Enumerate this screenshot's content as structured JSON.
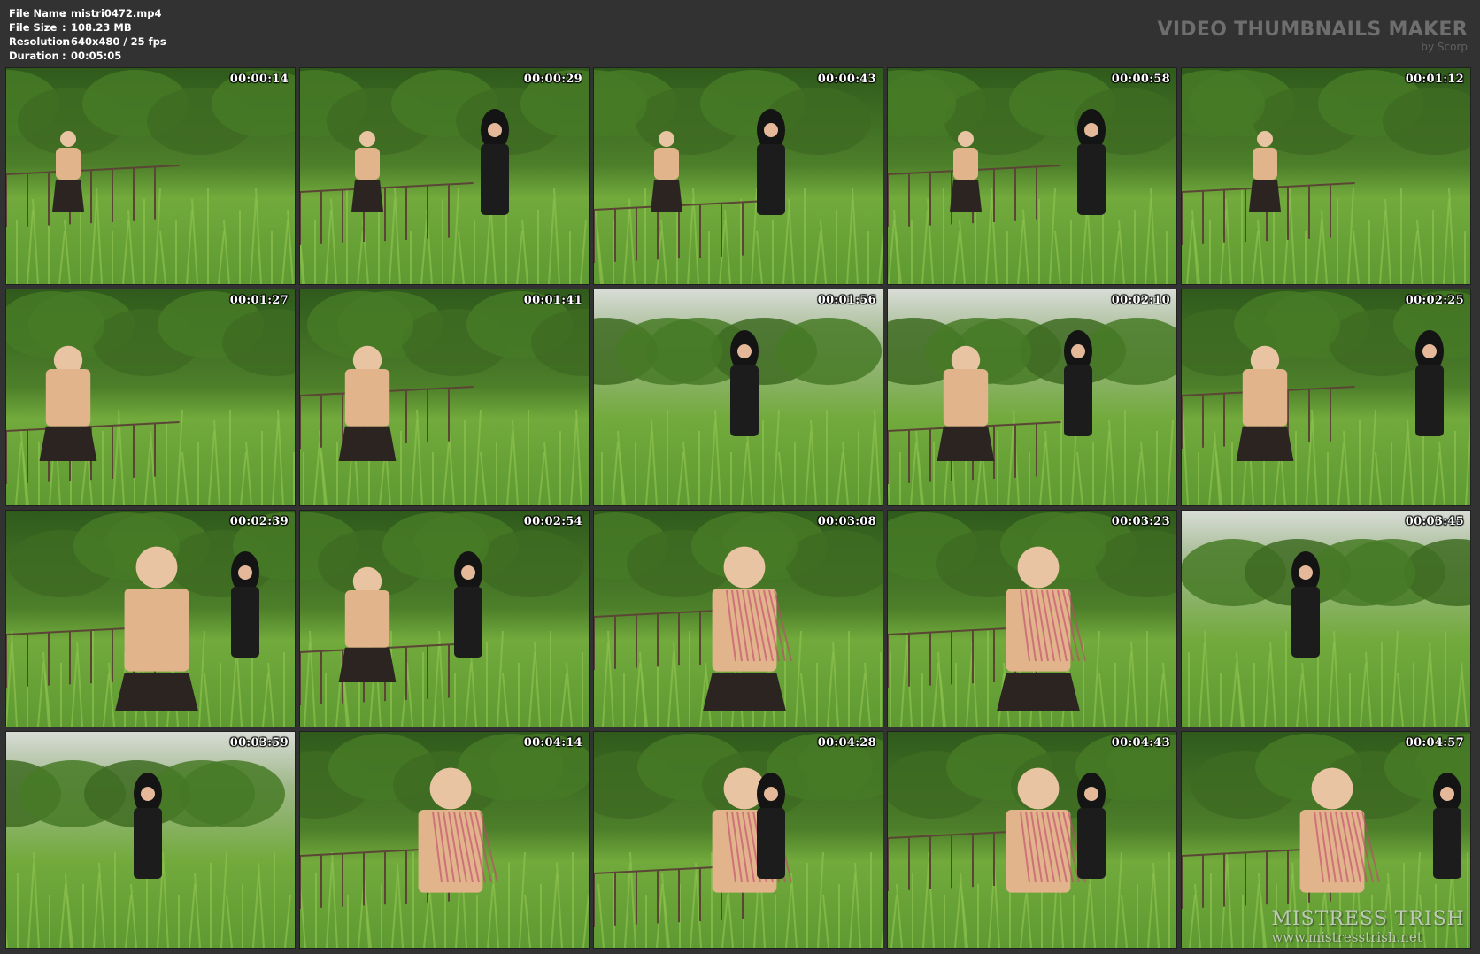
{
  "header": {
    "info": [
      {
        "label": "File Name",
        "sep": ":",
        "value": "mistri0472.mp4"
      },
      {
        "label": "File Size",
        "sep": ":",
        "value": "108.23 MB"
      },
      {
        "label": "Resolution",
        "sep": ":",
        "value": "640x480 / 25 fps"
      },
      {
        "label": "Duration",
        "sep": ":",
        "value": "00:05:05"
      }
    ],
    "brand_title": "VIDEO THUMBNAILS MAKER",
    "brand_sub": "by Scorp"
  },
  "thumbnails": [
    {
      "time": "00:00:14"
    },
    {
      "time": "00:00:29"
    },
    {
      "time": "00:00:43"
    },
    {
      "time": "00:00:58"
    },
    {
      "time": "00:01:12"
    },
    {
      "time": "00:01:27"
    },
    {
      "time": "00:01:41"
    },
    {
      "time": "00:01:56"
    },
    {
      "time": "00:02:10"
    },
    {
      "time": "00:02:25"
    },
    {
      "time": "00:02:39"
    },
    {
      "time": "00:02:54"
    },
    {
      "time": "00:03:08"
    },
    {
      "time": "00:03:23"
    },
    {
      "time": "00:03:45"
    },
    {
      "time": "00:03:59"
    },
    {
      "time": "00:04:14"
    },
    {
      "time": "00:04:28"
    },
    {
      "time": "00:04:43"
    },
    {
      "time": "00:04:57"
    }
  ],
  "watermark": {
    "name": "MISTRESS TRISH",
    "url": "www.mistresstrish.net"
  },
  "colors": {
    "background": "#323232",
    "grass": "#6fae3a",
    "foliage": "#3e6b22",
    "skin": "#e2b48c",
    "skirt": "#2b2421"
  }
}
